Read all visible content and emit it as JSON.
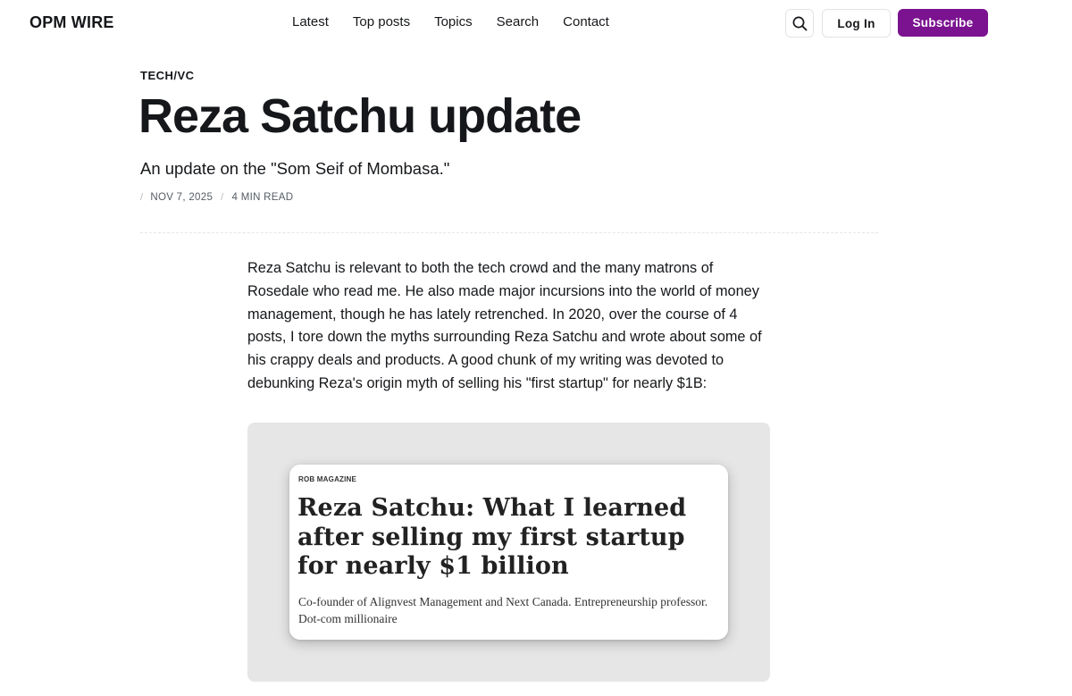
{
  "header": {
    "logo": "OPM WIRE",
    "nav": [
      "Latest",
      "Top posts",
      "Topics",
      "Search",
      "Contact"
    ],
    "search_icon": "search-icon",
    "login_label": "Log In",
    "subscribe_label": "Subscribe",
    "accent_color": "#7b1290"
  },
  "article": {
    "tag": "TECH/VC",
    "title": "Reza Satchu update",
    "excerpt": "An update on the \"Som Seif of Mombasa.\"",
    "date": "NOV 7, 2025",
    "read_time": "4 MIN READ",
    "body": "Reza Satchu is relevant to both the tech crowd and the many matrons of Rosedale who read me. He also made major incursions into the world of money management, though he has lately retrenched. In 2020, over the course of 4 posts, I tore down the myths surrounding Reza Satchu and wrote about some of his crappy deals and products. A good chunk of my writing was devoted to debunking Reza's origin myth of selling his \"first startup\" for nearly $1B:",
    "embed": {
      "source": "ROB MAGAZINE",
      "headline": "Reza Satchu: What I learned after selling my first startup for nearly $1 billion",
      "subtitle": "Co-founder of Alignvest Management and Next Canada. Entrepreneurship professor. Dot-com millionaire"
    }
  }
}
